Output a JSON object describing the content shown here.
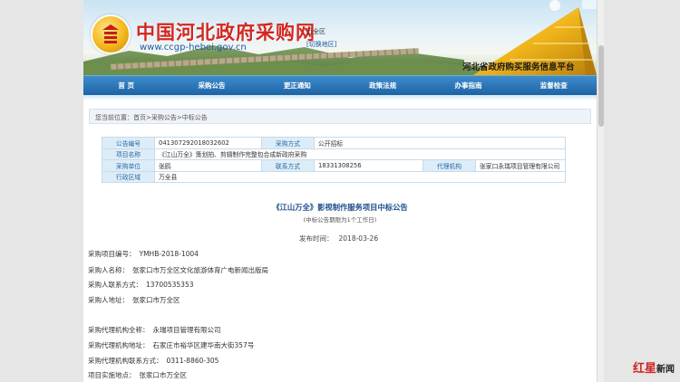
{
  "header": {
    "site_title": "中国河北政府采购网",
    "site_url": "www.ccgp-hebei.gov.cn",
    "region": "万全区",
    "region_switch": "[切换地区]",
    "platform_name": "河北省政府购买服务信息平台"
  },
  "nav": {
    "items": [
      "首 页",
      "采购公告",
      "更正通知",
      "政策法规",
      "办事指南",
      "监督检查"
    ]
  },
  "breadcrumb": {
    "prefix": "您当前位置：",
    "path": "首页>采购公告>中标公告"
  },
  "info_table": {
    "notice_no_label": "公告编号",
    "notice_no": "041307292018032602",
    "method_label": "采购方式",
    "method": "公开招标",
    "project_label": "项目名称",
    "project": "《江山万全》策划拍、剪辑制作完整包合成新政府采购",
    "buyer_label": "采购单位",
    "buyer": "张鸥",
    "phone_label": "联系方式",
    "phone": "18331308256",
    "agency_label": "代理机构",
    "agency": "张家口永瑞项目管理有限公司",
    "region_label": "行政区域",
    "region": "万全县"
  },
  "article": {
    "title": "《江山万全》影视制作服务项目中标公告",
    "subtitle": "(中标公告期限为1个工作日)",
    "date_label": "发布时间：",
    "date": "2018-03-26",
    "lines": [
      {
        "label": "采购项目编号：",
        "value": "YMHB-2018-1004"
      },
      {
        "label": "采购人名称：",
        "value": "张家口市万全区文化旅游体育广电新闻出版局"
      },
      {
        "label": "采购人联系方式：",
        "value": "13700535353"
      },
      {
        "label": "采购人地址：",
        "value": "张家口市万全区"
      },
      {
        "label": "采购代理机构全称：",
        "value": "永瑞项目管理有限公司"
      },
      {
        "label": "采购代理机构地址：",
        "value": "石家庄市裕华区建华南大街357号"
      },
      {
        "label": "采购代理机构联系方式：",
        "value": "0311-8860-305"
      },
      {
        "label": "项目实施地点：",
        "value": "张家口市万全区"
      }
    ]
  },
  "watermark": {
    "brand": "红星",
    "suffix": "新闻"
  },
  "colors": {
    "title_red": "#d3281f",
    "nav_blue": "#1d63a6",
    "label_blue": "#2a6aa5"
  }
}
